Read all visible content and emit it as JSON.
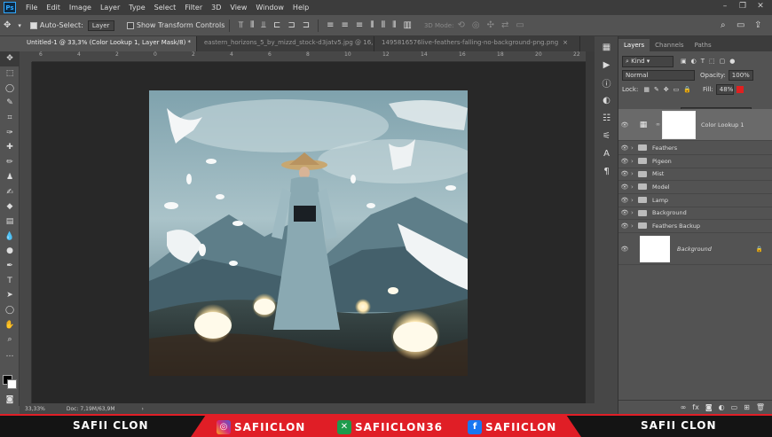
{
  "menu": [
    "File",
    "Edit",
    "Image",
    "Layer",
    "Type",
    "Select",
    "Filter",
    "3D",
    "View",
    "Window",
    "Help"
  ],
  "options": {
    "auto_select": "Auto-Select:",
    "layer_select": "Layer",
    "transform_controls": "Show Transform Controls",
    "mode_3d": "3D Mode:"
  },
  "tabs": [
    {
      "label": "Untitled-1 @ 33,3% (Color Lookup 1, Layer Mask/8) *"
    },
    {
      "label": "eastern_horizons_5_by_mizzd_stock-d3jatv5.jpg @ 16,..."
    },
    {
      "label": "1495816576live-feathers-falling-no-background-png.png"
    }
  ],
  "ruler_h": [
    "6",
    "4",
    "2",
    "0",
    "2",
    "4",
    "6",
    "8",
    "10",
    "12",
    "14",
    "16",
    "18",
    "20",
    "22"
  ],
  "status": {
    "zoom": "33,33%",
    "doc": "Doc: 7,19M/63,9M"
  },
  "layers_panel": {
    "tabs": [
      "Layers",
      "Channels",
      "Paths"
    ],
    "kind": "Kind",
    "blend_mode": "Normal",
    "opacity_label": "Opacity:",
    "opacity_value": "100%",
    "lock_label": "Lock:",
    "fill_label": "Fill:",
    "fill_value": "48%",
    "layers": [
      {
        "name": "Color Lookup 1"
      },
      {
        "name": "Feathers"
      },
      {
        "name": "Pigeon"
      },
      {
        "name": "Mist"
      },
      {
        "name": "Model"
      },
      {
        "name": "Lamp"
      },
      {
        "name": "Background"
      },
      {
        "name": "Feathers Backup"
      },
      {
        "name": "Background"
      }
    ]
  },
  "banner": {
    "left_name": "SAFII CLON",
    "right_name": "SAFII CLON",
    "instagram": "SAFIICLON",
    "other": "SAFIICLON36",
    "facebook": "SAFIICLON"
  },
  "colors": {
    "banner_red": "#e01e26",
    "ps_blue": "#31a8ff"
  }
}
